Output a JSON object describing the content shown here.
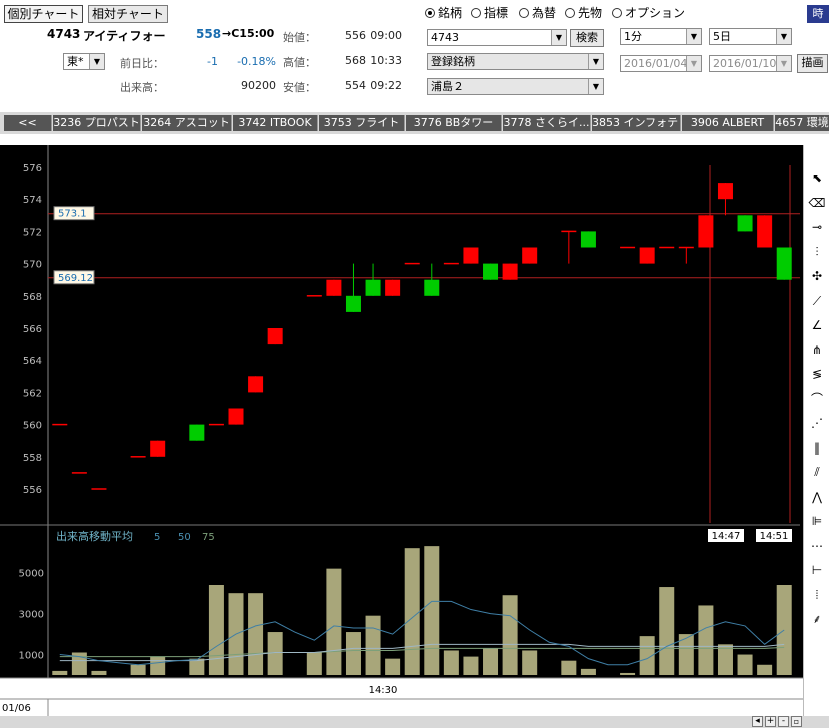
{
  "mode_buttons": {
    "individual": "個別チャート",
    "relative": "相対チャート"
  },
  "quote": {
    "code": "4743",
    "name": "アイティフォー",
    "price": "558",
    "price_suffix": "→C15:00",
    "market": "東*",
    "change_label": "前日比：",
    "change": "-1",
    "change_pct": "-0.18%",
    "volume_label": "出来高：",
    "volume": "90200",
    "open_label": "始値：",
    "open": "556",
    "open_time": "09:00",
    "high_label": "高値：",
    "high": "568",
    "high_time": "10:33",
    "low_label": "安値：",
    "low": "554",
    "low_time": "09:22"
  },
  "radios": [
    {
      "label": "銘柄",
      "selected": true
    },
    {
      "label": "指標",
      "selected": false
    },
    {
      "label": "為替",
      "selected": false
    },
    {
      "label": "先物",
      "selected": false
    },
    {
      "label": "オプション",
      "selected": false
    }
  ],
  "symbol_input": "4743",
  "search_button": "検索",
  "watchlist_select": "登録銘柄",
  "group_select": "浦島２",
  "interval_select": "1分",
  "period_select": "5日",
  "date_from": "2016/01/04",
  "date_to": "2016/01/10",
  "draw_button": "描画",
  "corner_button": "時",
  "tabs": [
    "<<",
    "3236 プロパスト",
    "3264 アスコット",
    "3742 ITBOOK",
    "3753 フライト",
    "3776 BBタワー",
    "3778 さくらイ...",
    "3853 インフォテリ",
    "3906 ALBERT",
    "4657 環境"
  ],
  "colors": {
    "up": "#ff0000",
    "down": "#00cc00",
    "volume_bar": "#a8a67a",
    "chart_bg": "#000000",
    "ref_line": "#b02020"
  },
  "chart_data": {
    "type": "candlestick",
    "yticks": [
      556,
      558,
      560,
      562,
      564,
      566,
      568,
      570,
      572,
      574,
      576
    ],
    "ylim": [
      554,
      577
    ],
    "ref_lines": [
      573.1,
      569.12
    ],
    "ref_labels": [
      "573.1",
      "569.12"
    ],
    "crosshair_labels": [
      "14:47",
      "14:51"
    ],
    "candles": [
      {
        "o": 560,
        "h": 560,
        "l": 560,
        "c": 560
      },
      {
        "o": 557,
        "h": 557,
        "l": 557,
        "c": 557
      },
      {
        "o": 556,
        "h": 556,
        "l": 556,
        "c": 556
      },
      null,
      {
        "o": 558,
        "h": 558,
        "l": 558,
        "c": 558
      },
      {
        "o": 558,
        "h": 559,
        "l": 558,
        "c": 559
      },
      null,
      {
        "o": 560,
        "h": 560,
        "l": 559,
        "c": 559
      },
      {
        "o": 560,
        "h": 560,
        "l": 560,
        "c": 560
      },
      {
        "o": 560,
        "h": 561,
        "l": 560,
        "c": 561
      },
      {
        "o": 562,
        "h": 563,
        "l": 562,
        "c": 563
      },
      {
        "o": 565,
        "h": 566,
        "l": 565,
        "c": 566
      },
      null,
      {
        "o": 568,
        "h": 568,
        "l": 568,
        "c": 568
      },
      {
        "o": 568,
        "h": 569,
        "l": 568,
        "c": 569
      },
      {
        "o": 568,
        "h": 570,
        "l": 567,
        "c": 567
      },
      {
        "o": 569,
        "h": 570,
        "l": 568,
        "c": 568
      },
      {
        "o": 568,
        "h": 569,
        "l": 568,
        "c": 569
      },
      {
        "o": 570,
        "h": 570,
        "l": 570,
        "c": 570
      },
      {
        "o": 569,
        "h": 570,
        "l": 568,
        "c": 568
      },
      {
        "o": 570,
        "h": 570,
        "l": 570,
        "c": 570
      },
      {
        "o": 570,
        "h": 571,
        "l": 570,
        "c": 571
      },
      {
        "o": 570,
        "h": 570,
        "l": 569,
        "c": 569
      },
      {
        "o": 569,
        "h": 570,
        "l": 569,
        "c": 570
      },
      {
        "o": 570,
        "h": 571,
        "l": 570,
        "c": 571
      },
      null,
      {
        "o": 572,
        "h": 572,
        "l": 570,
        "c": 572
      },
      {
        "o": 572,
        "h": 572,
        "l": 571,
        "c": 571
      },
      null,
      {
        "o": 571,
        "h": 571,
        "l": 571,
        "c": 571
      },
      {
        "o": 570,
        "h": 571,
        "l": 570,
        "c": 571
      },
      {
        "o": 571,
        "h": 571,
        "l": 571,
        "c": 571
      },
      {
        "o": 571,
        "h": 571,
        "l": 570,
        "c": 571
      },
      {
        "o": 571,
        "h": 573,
        "l": 571,
        "c": 573
      },
      {
        "o": 574,
        "h": 575,
        "l": 573,
        "c": 575
      },
      {
        "o": 573,
        "h": 573,
        "l": 572,
        "c": 572
      },
      {
        "o": 571,
        "h": 573,
        "l": 571,
        "c": 573
      },
      {
        "o": 571,
        "h": 571,
        "l": 569,
        "c": 569
      }
    ],
    "volume_title": "出来高移動平均",
    "volume_ma_periods": [
      "5",
      "50",
      "75"
    ],
    "volume_yticks": [
      1000,
      3000,
      5000
    ],
    "volume_ylim": [
      0,
      6600
    ],
    "volumes": [
      200,
      1100,
      200,
      0,
      500,
      900,
      0,
      800,
      4400,
      4000,
      4000,
      2100,
      0,
      1100,
      5200,
      2100,
      2900,
      800,
      6200,
      6300,
      1200,
      900,
      1300,
      3900,
      1200,
      0,
      700,
      300,
      0,
      100,
      1900,
      4300,
      2000,
      3400,
      1500,
      1000,
      500,
      4400
    ],
    "ma5": [
      1000,
      900,
      700,
      600,
      500,
      600,
      700,
      750,
      1400,
      2000,
      2400,
      2600,
      2100,
      1700,
      2400,
      2300,
      2300,
      2000,
      2800,
      3600,
      3600,
      3200,
      3000,
      2900,
      2200,
      1600,
      1400,
      800,
      500,
      500,
      800,
      1400,
      1800,
      2300,
      2600,
      2400,
      1500,
      2200
    ],
    "ma50": [
      700,
      700,
      700,
      700,
      700,
      700,
      700,
      700,
      800,
      900,
      1000,
      1100,
      1100,
      1100,
      1200,
      1300,
      1300,
      1300,
      1400,
      1500,
      1500,
      1500,
      1500,
      1500,
      1500,
      1500,
      1500,
      1400,
      1400,
      1400,
      1400,
      1400,
      1400,
      1400,
      1400,
      1400,
      1400,
      1500
    ],
    "ma75": [
      900,
      900,
      900,
      900,
      900,
      900,
      900,
      900,
      950,
      1000,
      1050,
      1100,
      1100,
      1100,
      1150,
      1200,
      1200,
      1200,
      1250,
      1300,
      1300,
      1300,
      1300,
      1300,
      1300,
      1300,
      1300,
      1300,
      1300,
      1300,
      1300,
      1300,
      1300,
      1300,
      1300,
      1300,
      1300,
      1350
    ],
    "x_label_time": "14:30",
    "x_label_date": "01/06"
  },
  "tools": [
    "cursor-icon",
    "eraser-icon",
    "horizontal-line-icon",
    "vertical-line-icon",
    "cross-line-icon",
    "trend-line-icon",
    "angle-line-icon",
    "fan-icon",
    "fibonacci-icon",
    "arc-icon",
    "speed-line-icon",
    "fibonacci-time-icon",
    "channel-icon",
    "gann-icon",
    "parallel-line-icon",
    "tri-line-icon",
    "range-icon",
    "grid-icon",
    "pattern-icon"
  ]
}
